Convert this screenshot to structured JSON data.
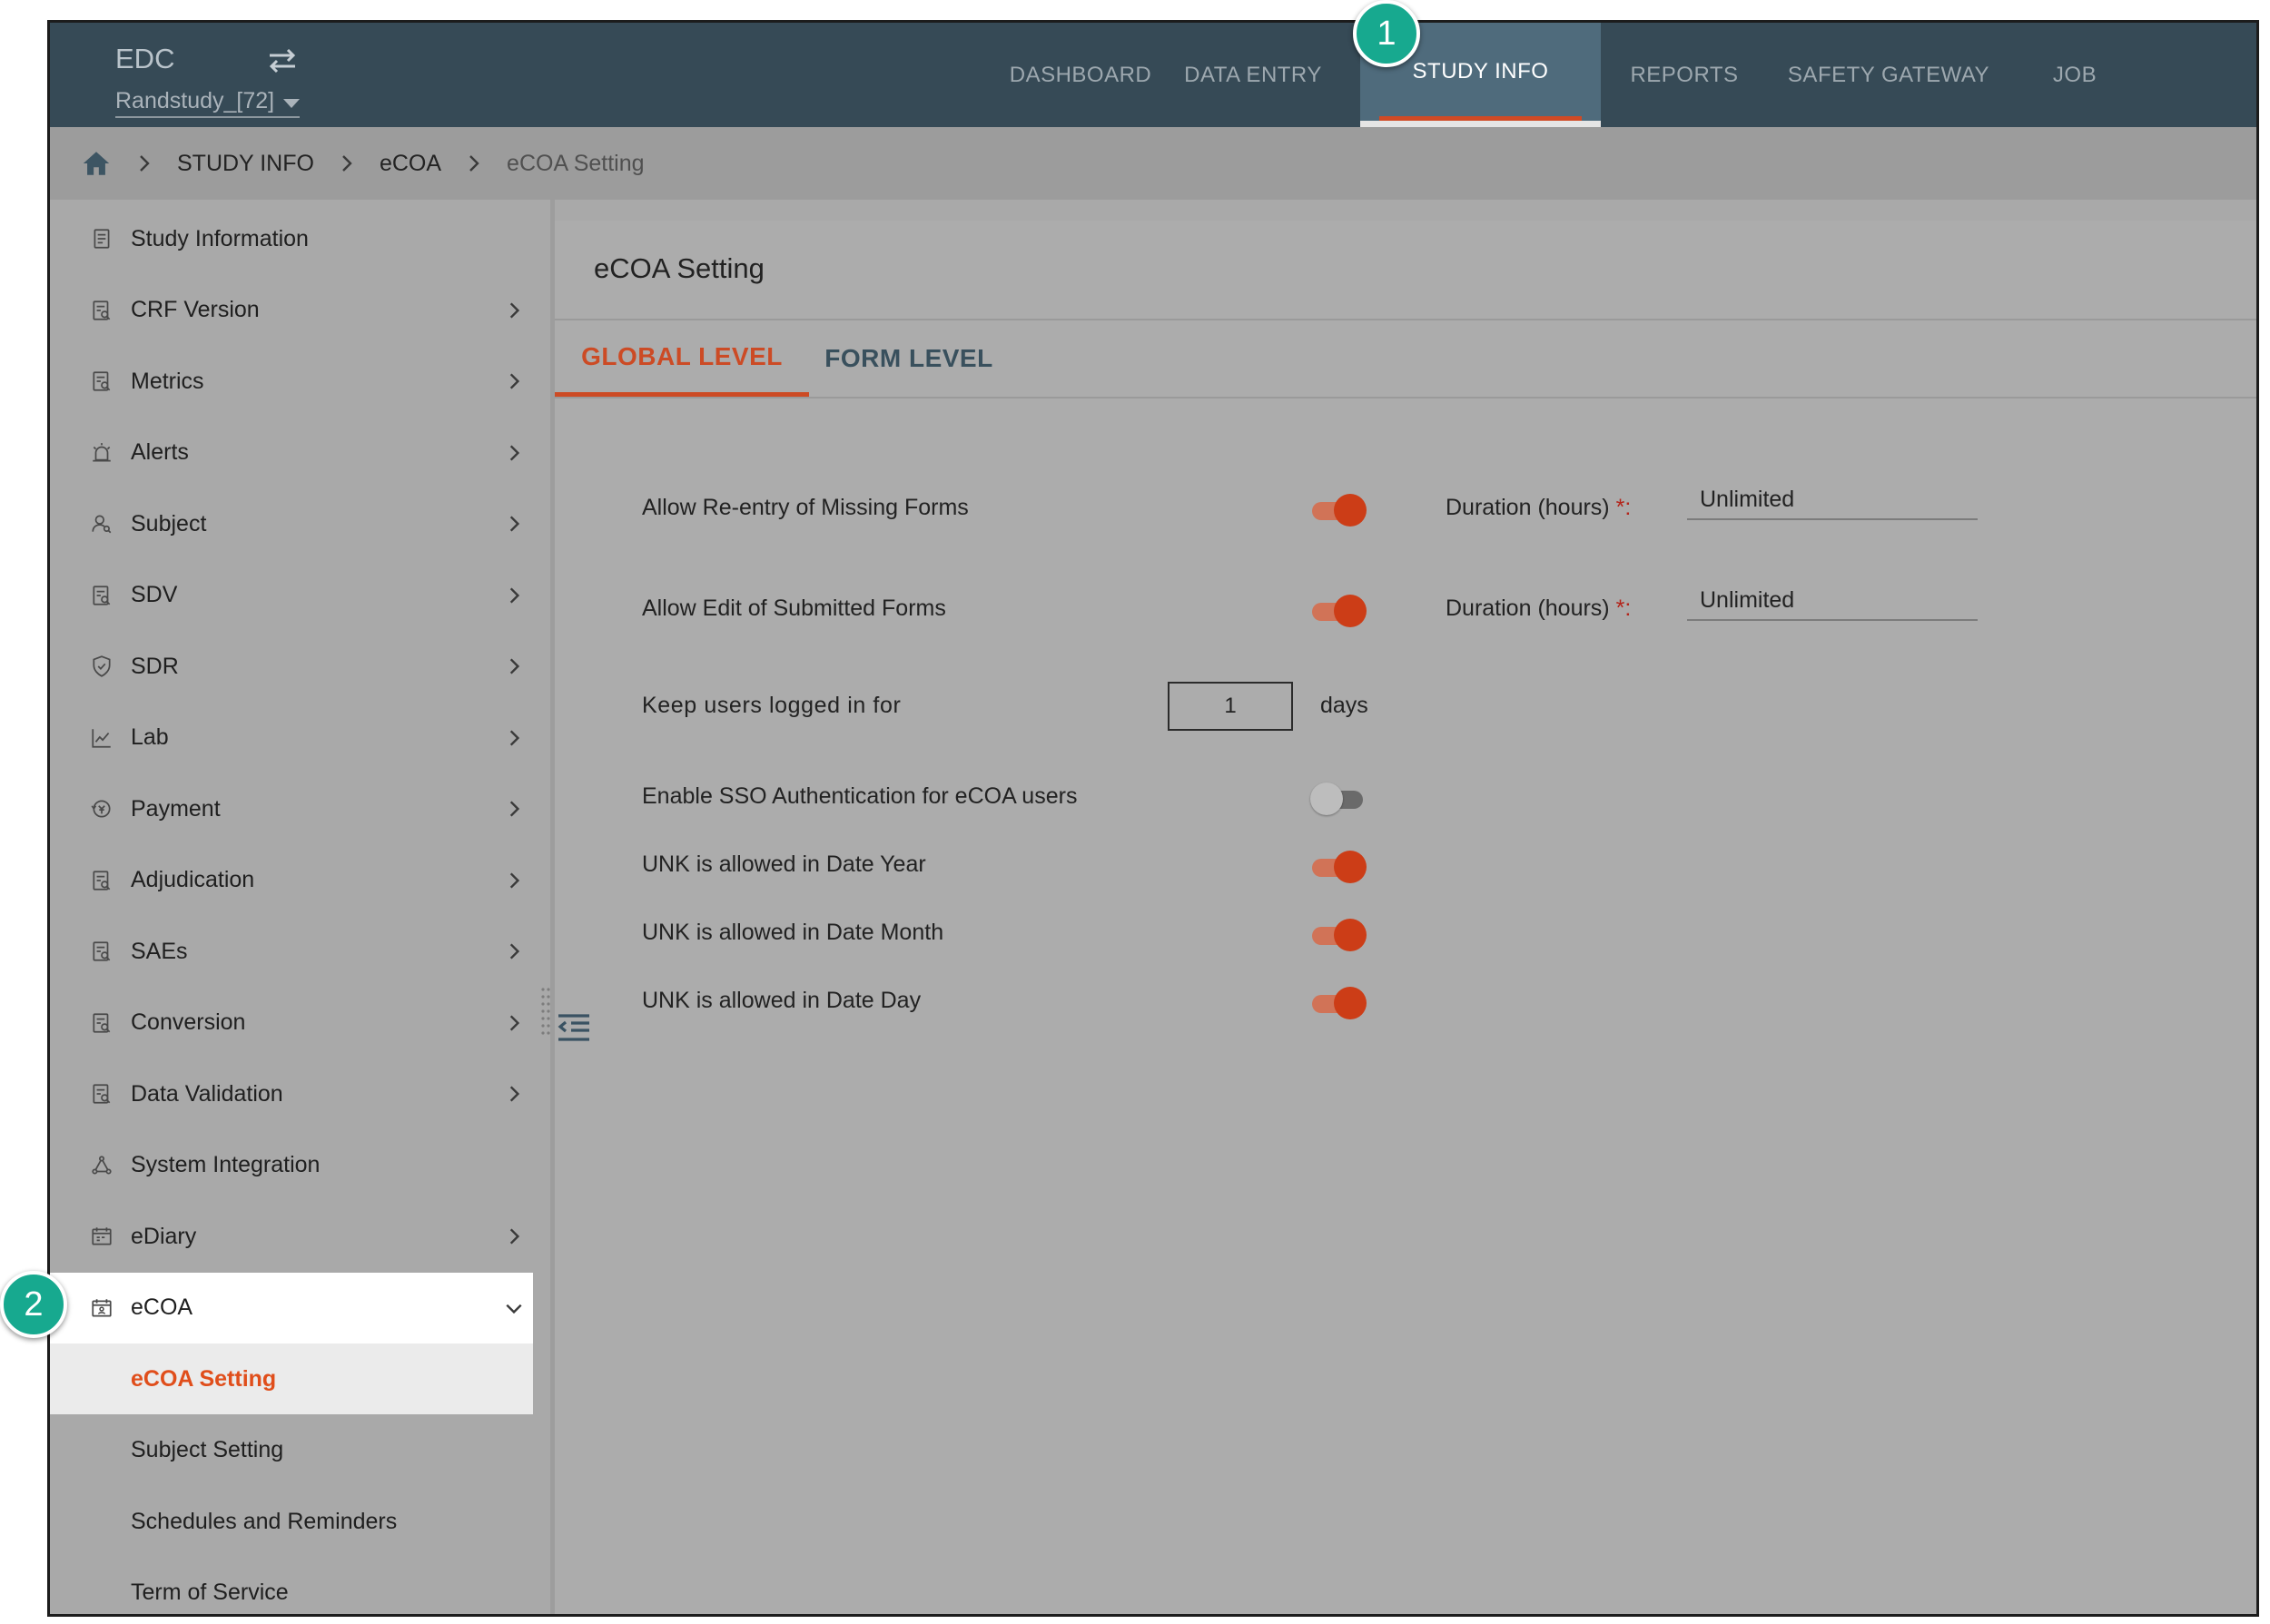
{
  "app": {
    "brand": "EDC",
    "study": "Randstudy_[72]"
  },
  "nav": {
    "items": [
      "DASHBOARD",
      "DATA ENTRY",
      "STUDY INFO",
      "REPORTS",
      "SAFETY GATEWAY",
      "JOB"
    ],
    "active": "STUDY INFO"
  },
  "breadcrumb": [
    "STUDY INFO",
    "eCOA",
    "eCOA Setting"
  ],
  "sidebar": {
    "items": [
      {
        "label": "Study Information",
        "icon": "document-icon",
        "chevron": false
      },
      {
        "label": "CRF Version",
        "icon": "form-search-icon",
        "chevron": true
      },
      {
        "label": "Metrics",
        "icon": "form-search-icon",
        "chevron": true
      },
      {
        "label": "Alerts",
        "icon": "alarm-icon",
        "chevron": true
      },
      {
        "label": "Subject",
        "icon": "user-search-icon",
        "chevron": true
      },
      {
        "label": "SDV",
        "icon": "form-search-icon",
        "chevron": true
      },
      {
        "label": "SDR",
        "icon": "shield-icon",
        "chevron": true
      },
      {
        "label": "Lab",
        "icon": "line-chart-icon",
        "chevron": true
      },
      {
        "label": "Payment",
        "icon": "payment-icon",
        "chevron": true
      },
      {
        "label": "Adjudication",
        "icon": "form-search-icon",
        "chevron": true
      },
      {
        "label": "SAEs",
        "icon": "form-search-icon",
        "chevron": true
      },
      {
        "label": "Conversion",
        "icon": "form-search-icon",
        "chevron": true
      },
      {
        "label": "Data Validation",
        "icon": "form-search-icon",
        "chevron": true
      },
      {
        "label": "System Integration",
        "icon": "network-icon",
        "chevron": false
      },
      {
        "label": "eDiary",
        "icon": "calendar-icon",
        "chevron": true
      },
      {
        "label": "eCOA",
        "icon": "calendar-person-icon",
        "chevron": "down"
      }
    ],
    "ecoa_sub": [
      "eCOA Setting",
      "Subject Setting",
      "Schedules and Reminders",
      "Term of Service"
    ]
  },
  "panel": {
    "title": "eCOA Setting",
    "tabs": [
      "GLOBAL LEVEL",
      "FORM LEVEL"
    ],
    "active_tab": "GLOBAL LEVEL",
    "settings": {
      "reentry": {
        "label": "Allow Re-entry of Missing Forms",
        "enabled": true,
        "duration_label": "Duration (hours)",
        "duration_value": "Unlimited"
      },
      "edit": {
        "label": "Allow Edit of Submitted Forms",
        "enabled": true,
        "duration_label": "Duration (hours)",
        "duration_value": "Unlimited"
      },
      "keep_logged": {
        "label": "Keep users logged in for",
        "value": "1",
        "unit": "days"
      },
      "sso": {
        "label": "Enable SSO Authentication for eCOA users",
        "enabled": false
      },
      "unk_year": {
        "label": "UNK is allowed in Date Year",
        "enabled": true
      },
      "unk_month": {
        "label": "UNK is allowed in Date Month",
        "enabled": true
      },
      "unk_day": {
        "label": "UNK is allowed in Date Day",
        "enabled": true
      }
    },
    "required_mark": "*",
    "colon": ":"
  },
  "callouts": [
    "1",
    "2"
  ],
  "colors": {
    "accent": "#cc4b25",
    "topbar": "#364a56",
    "callout": "#17a98f"
  }
}
